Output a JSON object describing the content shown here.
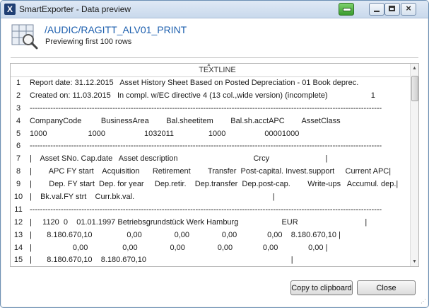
{
  "window": {
    "title": "SmartExporter - Data preview",
    "app_icon_glyph": "X"
  },
  "header": {
    "title": "/AUDIC/RAGITT_ALV01_PRINT",
    "subtitle": "Previewing first 100 rows",
    "icon": "table-magnifier-icon"
  },
  "grid": {
    "column_header": "TEXTLINE",
    "rows": [
      {
        "num": "1",
        "text": "Report date: 31.12.2015   Asset History Sheet Based on Posted Depreciation - 01 Book deprec."
      },
      {
        "num": "2",
        "text": "Created on: 11.03.2015   In compl. w/EC directive 4 (13 col.,wide version) (incomplete)                    1"
      },
      {
        "num": "3",
        "text": "----------------------------------------------------------------------------------------------------------------------------------------"
      },
      {
        "num": "4",
        "text": "CompanyCode         BusinessArea        Bal.sheetitem        Bal.sh.acctAPC        AssetClass"
      },
      {
        "num": "5",
        "text": "1000                   1000                  1032011                1000                  00001000"
      },
      {
        "num": "6",
        "text": "----------------------------------------------------------------------------------------------------------------------------------------"
      },
      {
        "num": "7",
        "text": "|    Asset SNo. Cap.date   Asset description                                   Crcy                          |"
      },
      {
        "num": "8",
        "text": "|        APC FY start    Acquisition      Retirement        Transfer  Post-capital. Invest.support     Current APC|"
      },
      {
        "num": "9",
        "text": "|        Dep. FY start  Dep. for year     Dep.retir.    Dep.transfer  Dep.post-cap.        Write-ups   Accumul. dep.|"
      },
      {
        "num": "10",
        "text": "|    Bk.val.FY strt    Curr.bk.val.                                                                |"
      },
      {
        "num": "11",
        "text": "----------------------------------------------------------------------------------------------------------------------------------------"
      },
      {
        "num": "12",
        "text": "|     1120  0    01.01.1997 Betriebsgrundstück Werk Hamburg                    EUR                               |"
      },
      {
        "num": "13",
        "text": "|       8.180.670,10                0,00               0,00               0,00              0,00    8.180.670,10 |"
      },
      {
        "num": "14",
        "text": "|                   0,00                0,00               0,00               0,00              0,00              0,00 |"
      },
      {
        "num": "15",
        "text": "|       8.180.670,10    8.180.670,10                                                                   |"
      }
    ]
  },
  "buttons": {
    "copy": "Copy to clipboard",
    "close": "Close"
  }
}
